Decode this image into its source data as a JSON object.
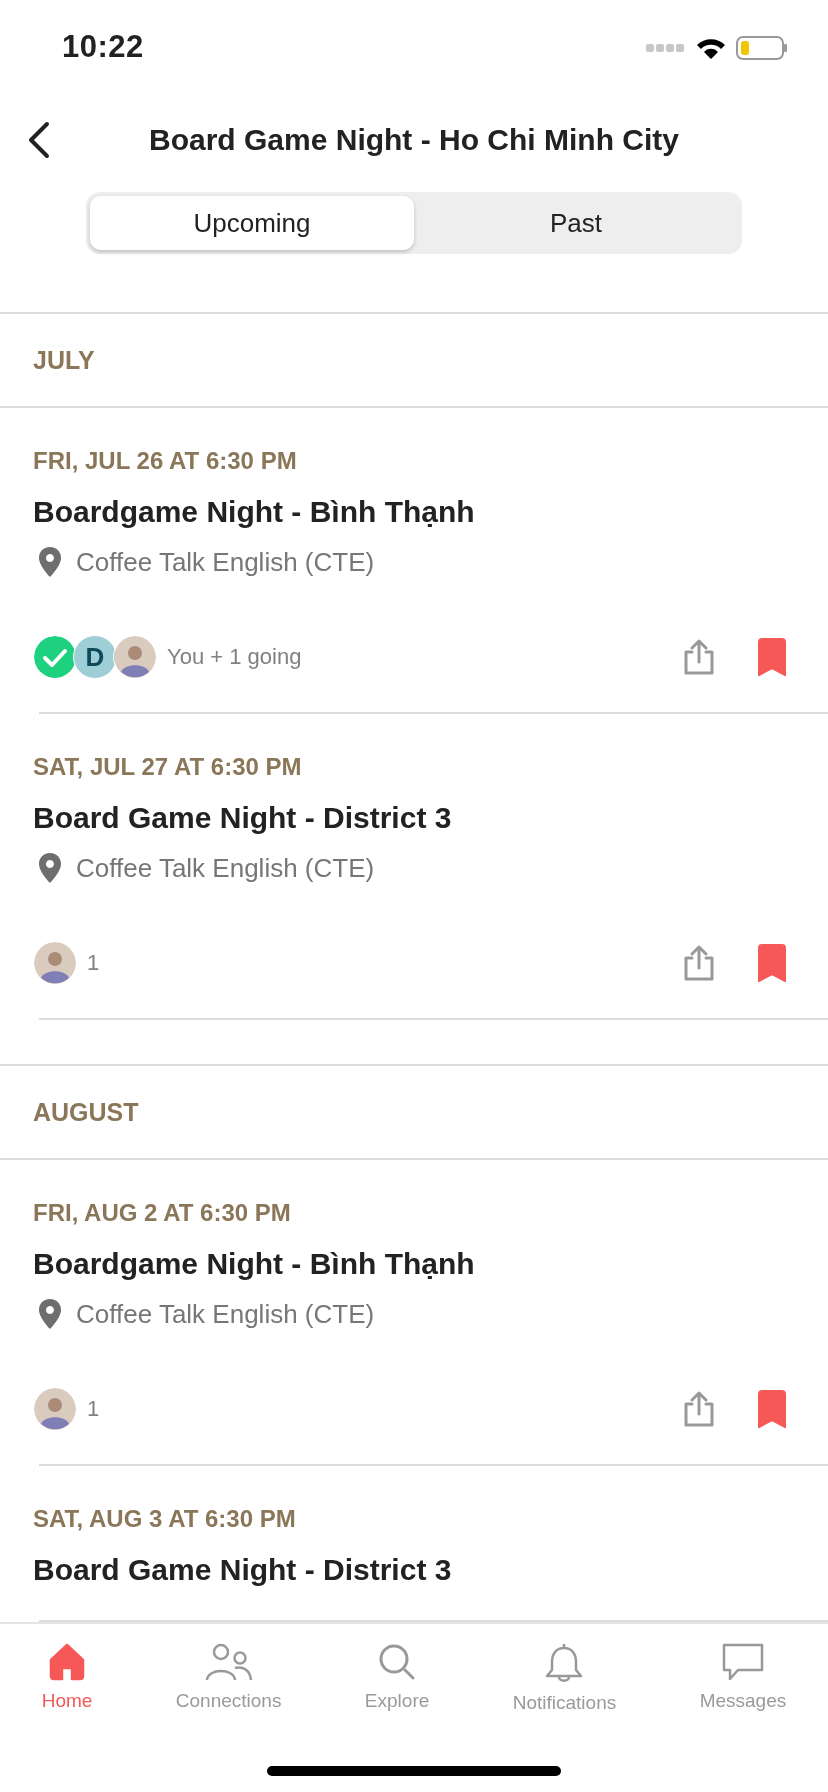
{
  "status_bar": {
    "time": "10:22"
  },
  "header": {
    "title": "Board Game Night - Ho Chi Minh City"
  },
  "tabs": [
    {
      "label": "Upcoming",
      "selected": true
    },
    {
      "label": "Past",
      "selected": false
    }
  ],
  "months": [
    {
      "name": "JULY",
      "events": [
        {
          "date": "FRI, JUL 26 AT 6:30 PM",
          "title": "Boardgame Night - Bình Thạnh",
          "venue": "Coffee Talk English (CTE)",
          "attendees": [
            {
              "kind": "check"
            },
            {
              "kind": "initial",
              "initial": "D"
            },
            {
              "kind": "photo"
            }
          ],
          "going": "You + 1 going",
          "saved": true
        },
        {
          "date": "SAT, JUL 27 AT 6:30 PM",
          "title": "Board Game Night - District 3",
          "venue": "Coffee Talk English (CTE)",
          "attendees": [
            {
              "kind": "photo"
            }
          ],
          "going": "1",
          "saved": true
        }
      ]
    },
    {
      "name": "AUGUST",
      "events": [
        {
          "date": "FRI, AUG 2 AT 6:30 PM",
          "title": "Boardgame Night - Bình Thạnh",
          "venue": "Coffee Talk English (CTE)",
          "attendees": [
            {
              "kind": "photo"
            }
          ],
          "going": "1",
          "saved": true
        },
        {
          "date": "SAT, AUG 3 AT 6:30 PM",
          "title": "Board Game Night - District 3"
        }
      ]
    }
  ],
  "tab_bar": [
    {
      "kind": "home",
      "label": "Home",
      "selected": true
    },
    {
      "kind": "connections",
      "label": "Connections",
      "selected": false
    },
    {
      "kind": "explore",
      "label": "Explore",
      "selected": false
    },
    {
      "kind": "notifications",
      "label": "Notifications",
      "selected": false
    },
    {
      "kind": "messages",
      "label": "Messages",
      "selected": false
    }
  ]
}
